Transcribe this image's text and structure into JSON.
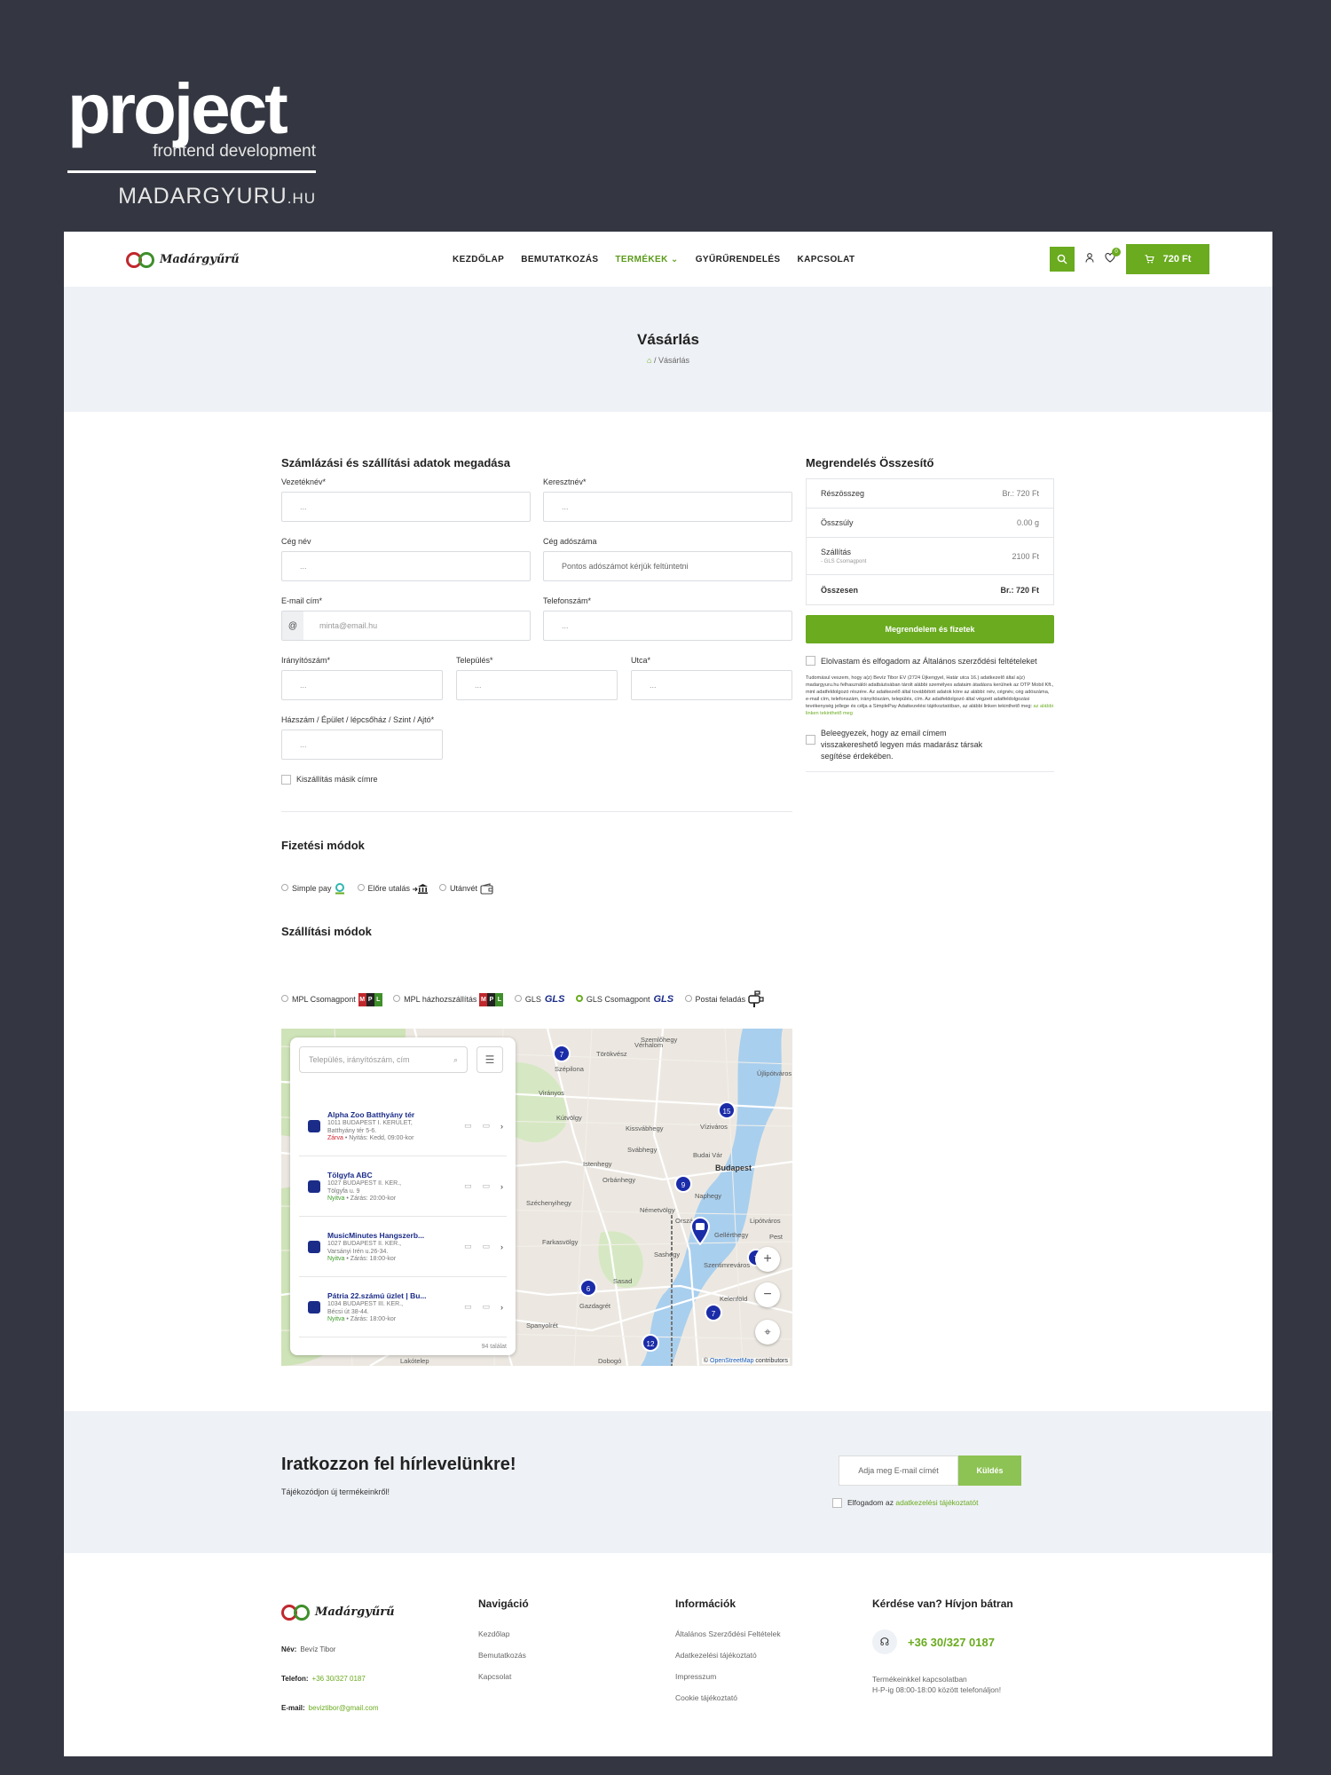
{
  "brand": {
    "word": "project",
    "sub": "frontend development",
    "site_main": "MADARGYURU",
    "site_tld": ".HU"
  },
  "header": {
    "logo_text": "Madárgyűrű",
    "nav": [
      {
        "label": "KEZDŐLAP"
      },
      {
        "label": "BEMUTATKOZÁS"
      },
      {
        "label": "TERMÉKEK"
      },
      {
        "label": "GYŰRŰRENDELÉS"
      },
      {
        "label": "KAPCSOLAT"
      }
    ],
    "wishlist_count": "0",
    "cart_total": "720 Ft"
  },
  "hero": {
    "title": "Vásárlás",
    "breadcrumb_current": "Vásárlás"
  },
  "billing": {
    "title": "Számlázási és szállítási adatok megadása",
    "lastname": {
      "label": "Vezetéknév*",
      "placeholder": "..."
    },
    "firstname": {
      "label": "Keresztnév*",
      "placeholder": "..."
    },
    "company": {
      "label": "Cég név",
      "placeholder": "..."
    },
    "taxid": {
      "label": "Cég adószáma",
      "placeholder": "Pontos adószámot kérjük feltüntetni"
    },
    "email": {
      "label": "E-mail cím*",
      "prefix": "@",
      "placeholder": "minta@email.hu"
    },
    "phone": {
      "label": "Telefonszám*",
      "placeholder": "..."
    },
    "zip": {
      "label": "Irányítószám*",
      "placeholder": "..."
    },
    "city": {
      "label": "Település*",
      "placeholder": "..."
    },
    "street": {
      "label": "Utca*",
      "placeholder": "..."
    },
    "house": {
      "label": "Házszám / Épület / lépcsőház / Szint / Ajtó*",
      "placeholder": "..."
    },
    "other_address": "Kiszállítás másik címre"
  },
  "payment": {
    "title": "Fizetési módok",
    "options": [
      {
        "label": "Simple pay"
      },
      {
        "label": "Előre utalás"
      },
      {
        "label": "Utánvét"
      }
    ]
  },
  "shipping": {
    "title": "Szállítási módok",
    "options": [
      {
        "label": "MPL Csomagpont"
      },
      {
        "label": "MPL házhozszállítás"
      },
      {
        "label": "GLS"
      },
      {
        "label": "GLS Csomagpont"
      },
      {
        "label": "Postai feladás"
      }
    ],
    "gls_logo": "GLS"
  },
  "map": {
    "search_placeholder": "Település, irányítószám, cím",
    "locations": [
      {
        "name": "Alpha Zoo Batthyány tér",
        "addr1": "1011 BUDAPEST I. KERÜLET,",
        "addr2": "Batthyány tér 5-6.",
        "status": "Zárva",
        "hours": " • Nyitás: Kedd, 09:00-kor"
      },
      {
        "name": "Tölgyfa ABC",
        "addr1": "1027 BUDAPEST II. KER.,",
        "addr2": "Tölgyfa u. 9",
        "status": "Nyitva",
        "hours": " • Zárás: 20:00-kor"
      },
      {
        "name": "MusicMinutes Hangszerb...",
        "addr1": "1027 BUDAPEST II. KER.,",
        "addr2": "Varsányi Irén u.26-34.",
        "status": "Nyitva",
        "hours": " • Zárás: 18:00-kor"
      },
      {
        "name": "Pátria 22.számú üzlet | Bu...",
        "addr1": "1034 BUDAPEST III. KER.,",
        "addr2": "Bécsi út 38-44.",
        "status": "Nyitva",
        "hours": " • Zárás: 18:00-kor"
      }
    ],
    "result_count": "94 találat",
    "clusters": [
      "7",
      "15",
      "9",
      "6",
      "7",
      "7",
      "12"
    ],
    "labels": [
      "Szemlőhegy",
      "Törökvész",
      "Vérhalom",
      "Szépilona",
      "Virányos",
      "Újlipótváros",
      "Víziváros",
      "Budai Vár",
      "Budapest",
      "Istenhegy",
      "Svábhegy",
      "Orbánhegy",
      "Naphegy",
      "Németvölgy",
      "Széchenyihegy",
      "Gellérthegy",
      "Farkasvölgy",
      "Sashegy",
      "Szentimreváros",
      "Országút",
      "Lipótváros",
      "Pest",
      "Sasad",
      "Gazdagrét",
      "Spanyolrét",
      "Kelenföld",
      "Lakótelep",
      "Dobogó",
      "Kútvölgy",
      "Kissvábhegy"
    ],
    "attribution_prefix": "©",
    "attribution_link": "OpenStreetMap",
    "attribution_suffix": "contributors"
  },
  "summary": {
    "title": "Megrendelés Összesítő",
    "rows": [
      {
        "label": "Részösszeg",
        "value": "Br.: 720 Ft"
      },
      {
        "label": "Összsúly",
        "value": "0.00 g"
      },
      {
        "label": "Szállítás",
        "note": "- GLS Csomagpont",
        "value": "2100 Ft"
      },
      {
        "label": "Összesen",
        "value": "Br.: 720 Ft"
      }
    ],
    "order_button": "Megrendelem és fizetek",
    "terms": "Elolvastam és elfogadom az Általános szerződési feltételeket",
    "legal_text": "Tudomásul veszem, hogy a(z) Bevíz Tibor EV (2724 Újkengyel, Határ utca 16.) adatkezelő által a(z) madargyuru.hu felhasználói adatbázisában tárolt alábbi személyes adataim átadásra kerülnek az OTP Mobil Kft., mint adatfeldolgozó részére. Az adatkezelő által továbbított adatok köre az alábbi: név, cégnév, cég adószáma, e-mail cím, telefonszám, irányítószám, település, cím. Az adatfeldolgozó által végzett adatfeldolgozási tevékenység jellege és célja a SimplePay Adatkezelési tájékoztatóban, az alábbi linken tekinthető meg:",
    "legal_link": "az alábbi linken tekinthető meg",
    "consent": "Beleegyezek, hogy az email címem visszakereshető legyen más madarász társak segítése érdekében."
  },
  "newsletter": {
    "title": "Iratkozzon fel hírlevelünkre!",
    "subtitle": "Tájékozódjon új termékeinkről!",
    "placeholder": "Adja meg E-mail címét",
    "button": "Küldés",
    "agree_prefix": "Elfogadom az",
    "agree_link": "adatkezelési tájékoztatót"
  },
  "footer": {
    "logo_text": "Madárgyűrű",
    "name_label": "Név:",
    "name_value": "Bevíz Tibor",
    "phone_label": "Telefon:",
    "phone_value": "+36 30/327 0187",
    "email_label": "E-mail:",
    "email_value": "beviztibor@gmail.com",
    "nav_title": "Navigáció",
    "nav_links": [
      {
        "label": "Kezdőlap"
      },
      {
        "label": "Bemutatkozás"
      },
      {
        "label": "Kapcsolat"
      }
    ],
    "info_title": "Információk",
    "info_links": [
      {
        "label": "Általános Szerződési Feltételek"
      },
      {
        "label": "Adatkezelési tájékoztató"
      },
      {
        "label": "Impresszum"
      },
      {
        "label": "Cookie tájékoztató"
      }
    ],
    "contact_title": "Kérdése van? Hívjon bátran",
    "contact_phone": "+36 30/327 0187",
    "contact_note1": "Termékeinkkel kapcsolatban",
    "contact_note2": "H-P-ig 08:00-18:00 között telefonáljon!"
  },
  "colors": {
    "accent": "#6aab1f",
    "dark_bg": "#343741",
    "light_bg": "#eef1f5",
    "map_marker": "#1b2ca8"
  }
}
